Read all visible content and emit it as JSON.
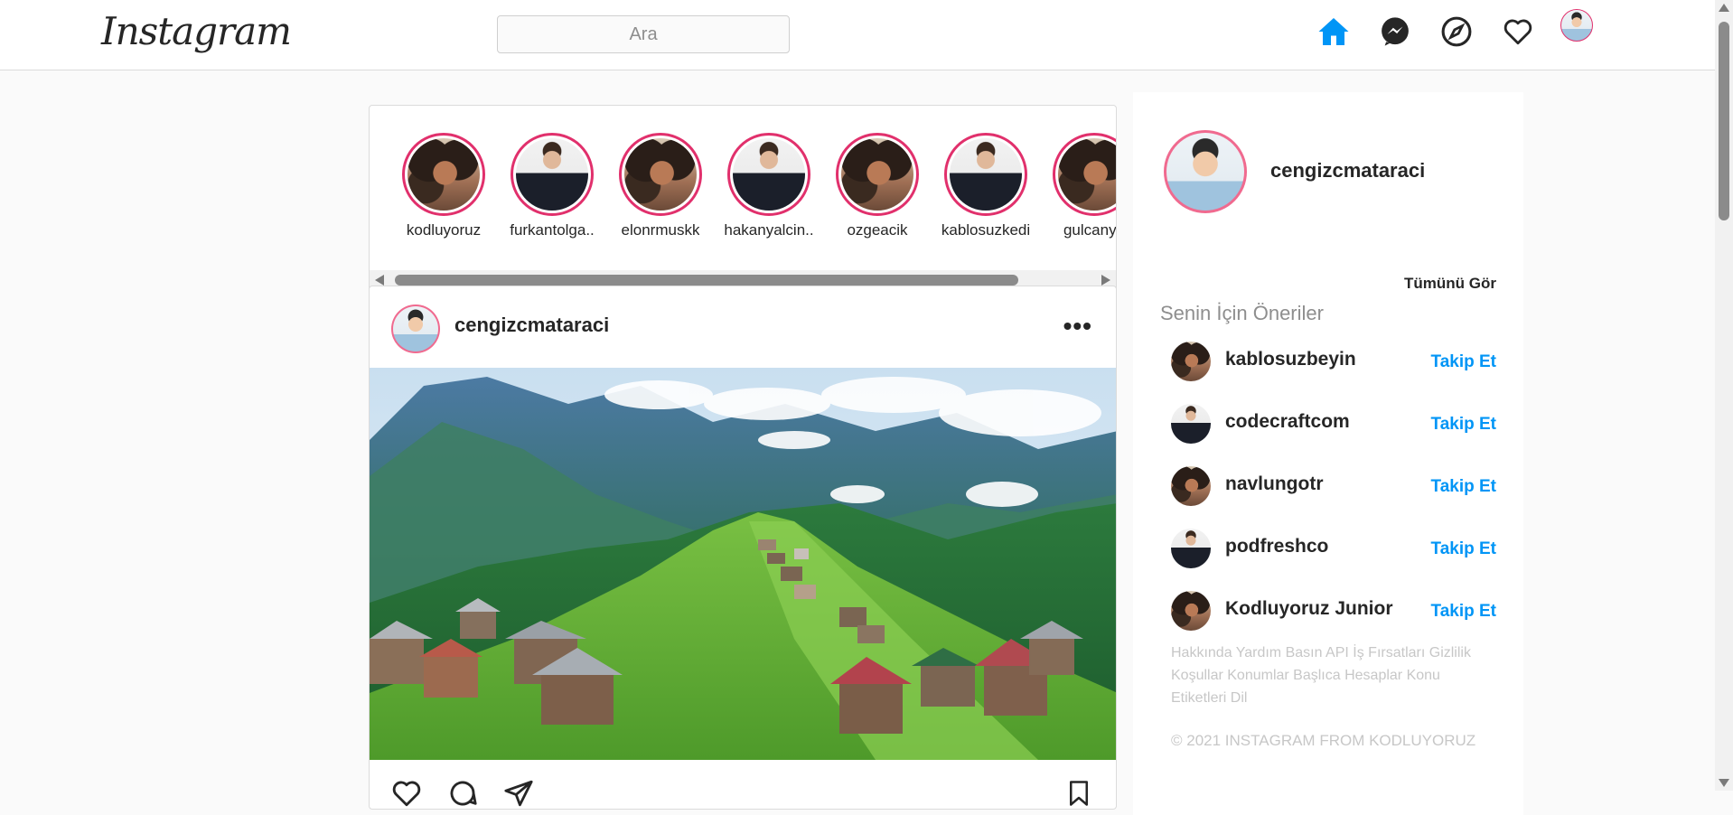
{
  "header": {
    "logo": "Instagram",
    "search_placeholder": "Ara",
    "icons": [
      "home-icon",
      "messenger-icon",
      "explore-icon",
      "heart-icon"
    ],
    "accent_color": "#0095f6"
  },
  "stories": {
    "items": [
      {
        "username": "kodluyoruz",
        "avatar": "woman"
      },
      {
        "username": "furkantolga..",
        "avatar": "man-suit"
      },
      {
        "username": "elonrmuskk",
        "avatar": "woman"
      },
      {
        "username": "hakanyalcin..",
        "avatar": "man-suit"
      },
      {
        "username": "ozgeacik",
        "avatar": "woman"
      },
      {
        "username": "kablosuzkedi",
        "avatar": "man-suit"
      },
      {
        "username": "gulcanya",
        "avatar": "woman"
      }
    ],
    "ring_color": "#e1306c"
  },
  "post": {
    "username": "cengizcmataraci",
    "more_label": "•••",
    "image_alt": "mountain-village-landscape"
  },
  "sidebar": {
    "current_user": "cengizcmataraci",
    "see_all": "Tümünü Gör",
    "suggestions_title": "Senin İçin Öneriler",
    "suggestions": [
      {
        "username": "kablosuzbeyin",
        "follow": "Takip Et",
        "avatar": "woman"
      },
      {
        "username": "codecraftcom",
        "follow": "Takip Et",
        "avatar": "man-suit"
      },
      {
        "username": "navlungotr",
        "follow": "Takip Et",
        "avatar": "woman"
      },
      {
        "username": "podfreshco",
        "follow": "Takip Et",
        "avatar": "man-suit"
      },
      {
        "username": "Kodluyoruz Junior",
        "follow": "Takip Et",
        "avatar": "woman"
      }
    ],
    "footer_links": "Hakkında Yardım Basın API İş Fırsatları Gizlilik Koşullar Konumlar Başlıca Hesaplar Konu Etiketleri Dil",
    "copyright": "© 2021 INSTAGRAM FROM KODLUYORUZ"
  }
}
